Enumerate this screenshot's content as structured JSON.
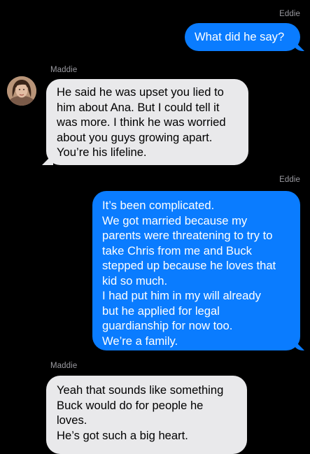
{
  "messages": [
    {
      "sender": "Eddie",
      "direction": "outgoing",
      "lines": [
        "What did he say?"
      ]
    },
    {
      "sender": "Maddie",
      "direction": "incoming",
      "lines": [
        "He said he was upset you lied to",
        "him about Ana. But I could tell it",
        "was more. I think he was worried",
        "about you guys growing apart.",
        "You’re his lifeline."
      ]
    },
    {
      "sender": "Eddie",
      "direction": "outgoing",
      "lines": [
        "It’s been complicated.",
        "We got married because my",
        "parents were threatening to try to",
        "take Chris from me and Buck",
        "stepped up because he loves that",
        "kid so much.",
        "I had put him in my will already",
        "but he applied for legal",
        "guardianship for now too.",
        "We’re a family."
      ]
    },
    {
      "sender": "Maddie",
      "direction": "incoming",
      "lines": [
        "Yeah that sounds like something",
        "Buck would do for people he",
        "loves.",
        "He’s got such a big heart."
      ]
    }
  ],
  "colors": {
    "background": "#000000",
    "outgoing_bubble": "#0a7cff",
    "incoming_bubble": "#e9e9eb",
    "sender_label": "#9a9aa0"
  }
}
